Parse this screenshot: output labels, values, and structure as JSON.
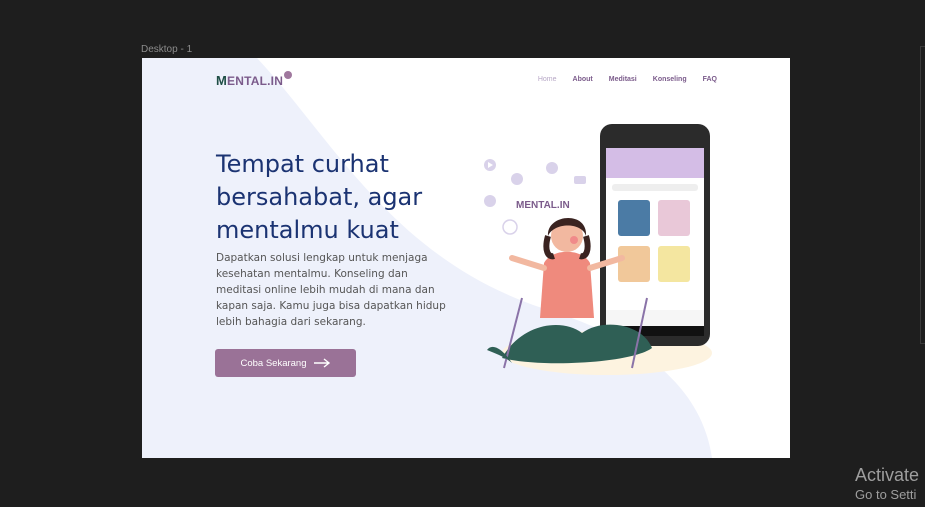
{
  "editor": {
    "frame_label": "Desktop - 1"
  },
  "site": {
    "logo_m": "M",
    "logo_rest": "ENTAL.IN",
    "nav": [
      {
        "label": "Home",
        "active": true
      },
      {
        "label": "About"
      },
      {
        "label": "Meditasi"
      },
      {
        "label": "Konseling"
      },
      {
        "label": "FAQ"
      }
    ],
    "hero_title": "Tempat curhat bersahabat, agar mentalmu kuat",
    "hero_desc": "Dapatkan solusi lengkap untuk menjaga kesehatan mentalmu. Konseling dan meditasi online lebih mudah di mana dan kapan saja. Kamu juga bisa dapatkan hidup lebih bahagia dari sekarang.",
    "cta_label": "Coba Sekarang",
    "colors": {
      "primary": "#9a7297",
      "heading": "#1b3372",
      "bg_shape": "#eef1fb"
    }
  },
  "os": {
    "watermark_line1": "Activate",
    "watermark_line2": "Go to Setti"
  }
}
